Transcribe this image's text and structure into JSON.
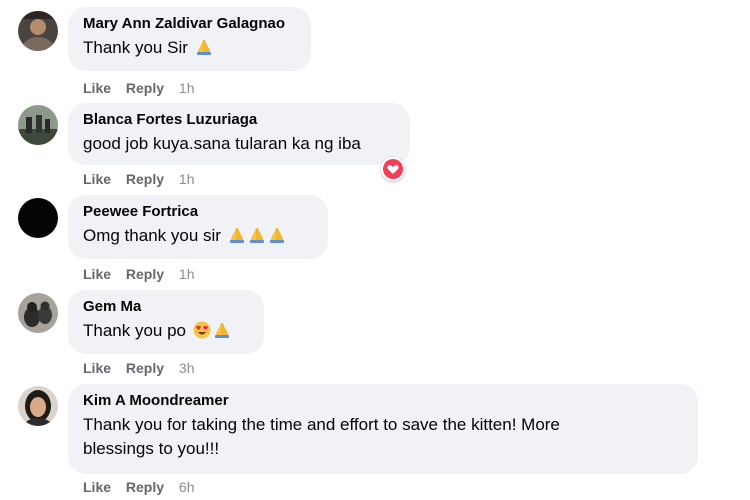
{
  "comments": [
    {
      "author": "Mary Ann Zaldivar Galagnao",
      "text": "Thank you Sir",
      "emojis": [
        "folded-hands"
      ],
      "like_label": "Like",
      "reply_label": "Reply",
      "time": "1h"
    },
    {
      "author": "Blanca Fortes Luzuriaga",
      "text": "good job kuya.sana tularan ka ng iba",
      "reaction": "love",
      "like_label": "Like",
      "reply_label": "Reply",
      "time": "1h"
    },
    {
      "author": "Peewee Fortrica",
      "text": "Omg thank you sir",
      "emojis": [
        "folded-hands",
        "folded-hands",
        "folded-hands"
      ],
      "like_label": "Like",
      "reply_label": "Reply",
      "time": "1h"
    },
    {
      "author": "Gem Ma",
      "text": "Thank you po",
      "emojis": [
        "heart-eyes",
        "folded-hands"
      ],
      "like_label": "Like",
      "reply_label": "Reply",
      "time": "3h"
    },
    {
      "author": "Kim A Moondreamer",
      "text_lines": [
        "Thank you for taking the time and effort to save the kitten! More",
        "blessings to you!!!"
      ],
      "like_label": "Like",
      "reply_label": "Reply",
      "time": "6h"
    }
  ],
  "colors": {
    "bubble": "#f0f2f5",
    "secondary_text": "#65676b",
    "love_reaction": "#f33e58",
    "emoji_yellow": "#f7c242"
  }
}
